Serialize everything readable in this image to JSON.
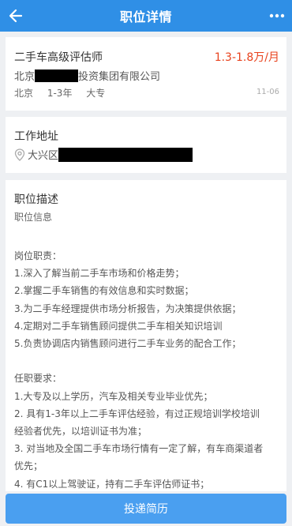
{
  "header": {
    "title": "职位详情",
    "back_icon": "arrow-left-icon",
    "more_icon": "more-dots-icon",
    "bar_color": "#2f8fe6"
  },
  "job": {
    "title": "二手车高级评估师",
    "salary": "1.3-1.8万/月",
    "salary_color": "#e8421d",
    "company_prefix": "北京",
    "company_suffix": "投资集团有限公司",
    "city": "北京",
    "experience": "1-3年",
    "education": "大专",
    "date": "11-06"
  },
  "address": {
    "title": "工作地址",
    "district": "大兴区",
    "icon": "location-pin-icon"
  },
  "description": {
    "title": "职位描述",
    "subtitle": "职位信息",
    "duties_title": "岗位职责：",
    "duties": [
      "1.深入了解当前二手车市场和价格走势；",
      "2.掌握二手车销售的有效信息和实时数据；",
      "3.为二手车经理提供市场分析报告，为决策提供依据；",
      "4.定期对二手车销售顾问提供二手车相关知识培训",
      "5.负责协调店内销售顾问进行二手车业务的配合工作；"
    ],
    "requirements_title": "任职要求：",
    "requirements": [
      "1.大专及以上学历，汽车及相关专业毕业优先；",
      "2. 具有1-3年以上二手车评估经验，有过正规培训学校培训",
      "经验者优先，以培训证书为准；",
      "3. 对当地及全国二手车市场行情有一定了解，有车商渠道者",
      "优先；",
      "4. 有C1以上驾驶证，持有二手车评估师证书；"
    ]
  },
  "footer": {
    "apply_label": "投递简历",
    "button_color": "#4a9ff0"
  }
}
